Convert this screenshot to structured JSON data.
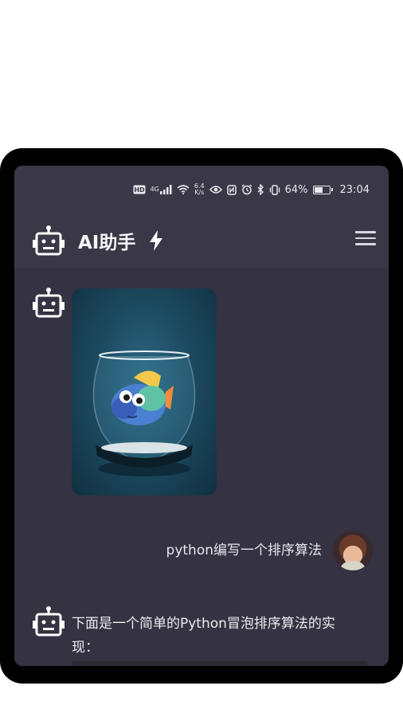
{
  "status_bar": {
    "hd_label": "HD",
    "network_label": "4G",
    "speed_value": "6.4",
    "speed_unit": "K/s",
    "battery_percent": "64%",
    "battery_level": 0.64,
    "time": "23:04"
  },
  "header": {
    "title": "AI助手"
  },
  "chat": {
    "user_message": "python编写一个排序算法",
    "bot_message": "下面是一个简单的Python冒泡排序算法的实现："
  },
  "icons": {
    "app": "robot-icon",
    "badge": "bolt-icon",
    "menu": "hamburger-menu-icon"
  },
  "colors": {
    "background": "#3a3846",
    "chat_background": "#353341",
    "text": "#ececf2"
  }
}
